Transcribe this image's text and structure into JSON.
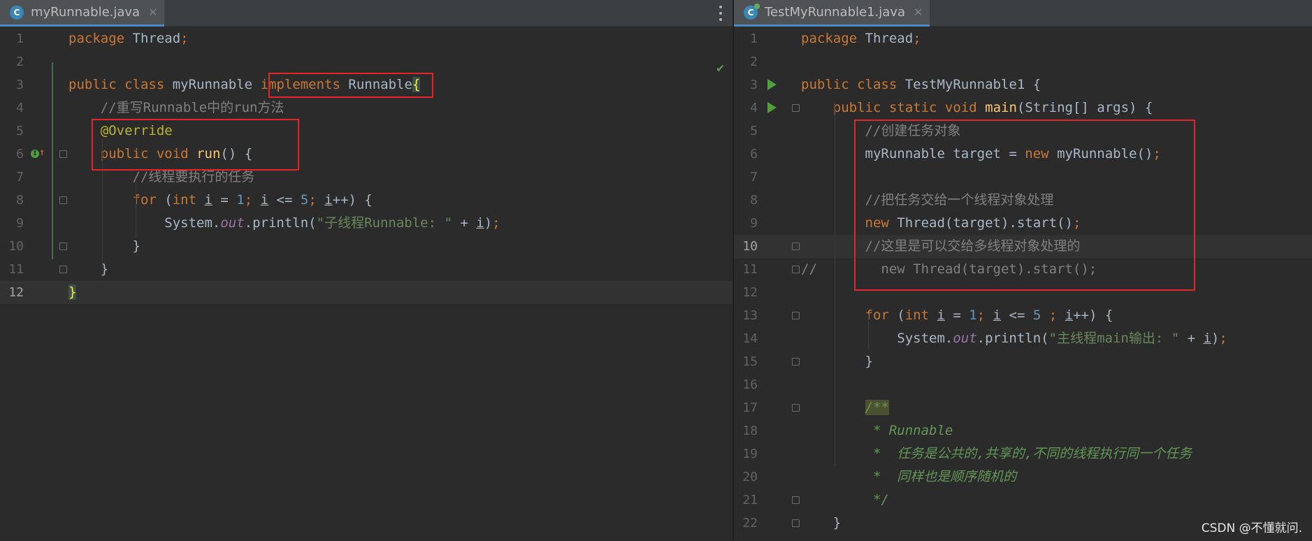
{
  "left": {
    "tab": {
      "label": "myRunnable.java",
      "icon_letter": "C",
      "close": "✕"
    },
    "lines": [
      {
        "n": "1",
        "tokens": [
          [
            "k",
            "package"
          ],
          [
            "cls",
            " Thread"
          ],
          [
            "k",
            ";"
          ]
        ]
      },
      {
        "n": "2",
        "tokens": []
      },
      {
        "n": "3",
        "tokens": [
          [
            "k",
            "public class"
          ],
          [
            "cls",
            " myRunnable "
          ],
          [
            "k",
            "implements"
          ],
          [
            "cls",
            " Runnable"
          ],
          [
            "brace-hl",
            "{"
          ]
        ]
      },
      {
        "n": "4",
        "tokens": [
          [
            "cls",
            "    "
          ],
          [
            "cmt",
            "//重写Runnable中的run方法"
          ]
        ]
      },
      {
        "n": "5",
        "tokens": [
          [
            "cls",
            "    "
          ],
          [
            "ann",
            "@Override"
          ]
        ]
      },
      {
        "n": "6",
        "tokens": [
          [
            "cls",
            "    "
          ],
          [
            "k",
            "public void"
          ],
          [
            "cls",
            " "
          ],
          [
            "fn",
            "run"
          ],
          [
            "cls",
            "() {"
          ]
        ]
      },
      {
        "n": "7",
        "tokens": [
          [
            "cls",
            "        "
          ],
          [
            "cmt",
            "//线程要执行的任务"
          ]
        ]
      },
      {
        "n": "8",
        "tokens": [
          [
            "cls",
            "        "
          ],
          [
            "k",
            "for"
          ],
          [
            "cls",
            " ("
          ],
          [
            "k",
            "int"
          ],
          [
            "cls",
            " "
          ],
          [
            "var",
            "i"
          ],
          [
            "cls",
            " = "
          ],
          [
            "num",
            "1"
          ],
          [
            "k",
            "; "
          ],
          [
            "var",
            "i"
          ],
          [
            "cls",
            " <= "
          ],
          [
            "num",
            "5"
          ],
          [
            "k",
            "; "
          ],
          [
            "var",
            "i"
          ],
          [
            "cls",
            "++) {"
          ]
        ]
      },
      {
        "n": "9",
        "tokens": [
          [
            "cls",
            "            System."
          ],
          [
            "fld",
            "out"
          ],
          [
            "cls",
            ".println("
          ],
          [
            "str",
            "\"子线程Runnable: \""
          ],
          [
            "cls",
            " + "
          ],
          [
            "var",
            "i"
          ],
          [
            "cls",
            ")"
          ],
          [
            "k",
            ";"
          ]
        ]
      },
      {
        "n": "10",
        "tokens": [
          [
            "cls",
            "        }"
          ]
        ]
      },
      {
        "n": "11",
        "tokens": [
          [
            "cls",
            "    }"
          ]
        ]
      },
      {
        "n": "12",
        "tokens": [
          [
            "brace-hl",
            "}"
          ]
        ]
      }
    ]
  },
  "right": {
    "tab": {
      "label": "TestMyRunnable1.java",
      "icon_letter": "C",
      "close": "✕"
    },
    "lines": [
      {
        "n": "1",
        "tokens": [
          [
            "k",
            "package"
          ],
          [
            "cls",
            " Thread"
          ],
          [
            "k",
            ";"
          ]
        ]
      },
      {
        "n": "2",
        "tokens": []
      },
      {
        "n": "3",
        "tokens": [
          [
            "k",
            "public class"
          ],
          [
            "cls",
            " TestMyRunnable1 {"
          ]
        ]
      },
      {
        "n": "4",
        "tokens": [
          [
            "cls",
            "    "
          ],
          [
            "k",
            "public static void"
          ],
          [
            "cls",
            " "
          ],
          [
            "fn",
            "main"
          ],
          [
            "cls",
            "(String[] args) {"
          ]
        ]
      },
      {
        "n": "5",
        "tokens": [
          [
            "cls",
            "        "
          ],
          [
            "cmt",
            "//创建任务对象"
          ]
        ]
      },
      {
        "n": "6",
        "tokens": [
          [
            "cls",
            "        myRunnable target = "
          ],
          [
            "k",
            "new"
          ],
          [
            "cls",
            " myRunnable()"
          ],
          [
            "k",
            ";"
          ]
        ]
      },
      {
        "n": "7",
        "tokens": []
      },
      {
        "n": "8",
        "tokens": [
          [
            "cls",
            "        "
          ],
          [
            "cmt",
            "//把任务交给一个线程对象处理"
          ]
        ]
      },
      {
        "n": "9",
        "tokens": [
          [
            "cls",
            "        "
          ],
          [
            "k",
            "new"
          ],
          [
            "cls",
            " Thread(target).start()"
          ],
          [
            "k",
            ";"
          ]
        ]
      },
      {
        "n": "10",
        "tokens": [
          [
            "cls",
            "        "
          ],
          [
            "cmt",
            "//这里是可以交给多线程对象处理的"
          ]
        ]
      },
      {
        "n": "11",
        "tokens": [
          [
            "cmt",
            "//        new Thread(target).start();"
          ]
        ]
      },
      {
        "n": "12",
        "tokens": []
      },
      {
        "n": "13",
        "tokens": [
          [
            "cls",
            "        "
          ],
          [
            "k",
            "for"
          ],
          [
            "cls",
            " ("
          ],
          [
            "k",
            "int"
          ],
          [
            "cls",
            " "
          ],
          [
            "var",
            "i"
          ],
          [
            "cls",
            " = "
          ],
          [
            "num",
            "1"
          ],
          [
            "k",
            "; "
          ],
          [
            "var",
            "i"
          ],
          [
            "cls",
            " <= "
          ],
          [
            "num",
            "5"
          ],
          [
            "k",
            " ; "
          ],
          [
            "var",
            "i"
          ],
          [
            "cls",
            "++) {"
          ]
        ]
      },
      {
        "n": "14",
        "tokens": [
          [
            "cls",
            "            System."
          ],
          [
            "fld",
            "out"
          ],
          [
            "cls",
            ".println("
          ],
          [
            "str",
            "\"主线程main输出: \""
          ],
          [
            "cls",
            " + "
          ],
          [
            "var",
            "i"
          ],
          [
            "cls",
            ")"
          ],
          [
            "k",
            ";"
          ]
        ]
      },
      {
        "n": "15",
        "tokens": [
          [
            "cls",
            "        }"
          ]
        ]
      },
      {
        "n": "16",
        "tokens": []
      },
      {
        "n": "17",
        "tokens": [
          [
            "cls",
            "        "
          ],
          [
            "doc-hl doc",
            "/**"
          ]
        ]
      },
      {
        "n": "18",
        "tokens": [
          [
            "cls",
            "         "
          ],
          [
            "doc",
            "* Runnable"
          ]
        ]
      },
      {
        "n": "19",
        "tokens": [
          [
            "cls",
            "         "
          ],
          [
            "doc",
            "*  任务是公共的,共享的,不同的线程执行同一个任务"
          ]
        ]
      },
      {
        "n": "20",
        "tokens": [
          [
            "cls",
            "         "
          ],
          [
            "doc",
            "*  同样也是顺序随机的"
          ]
        ]
      },
      {
        "n": "21",
        "tokens": [
          [
            "cls",
            "         "
          ],
          [
            "doc",
            "*/"
          ]
        ]
      },
      {
        "n": "22",
        "tokens": [
          [
            "cls",
            "    }"
          ]
        ]
      }
    ]
  },
  "watermark": "CSDN @不懂就问."
}
